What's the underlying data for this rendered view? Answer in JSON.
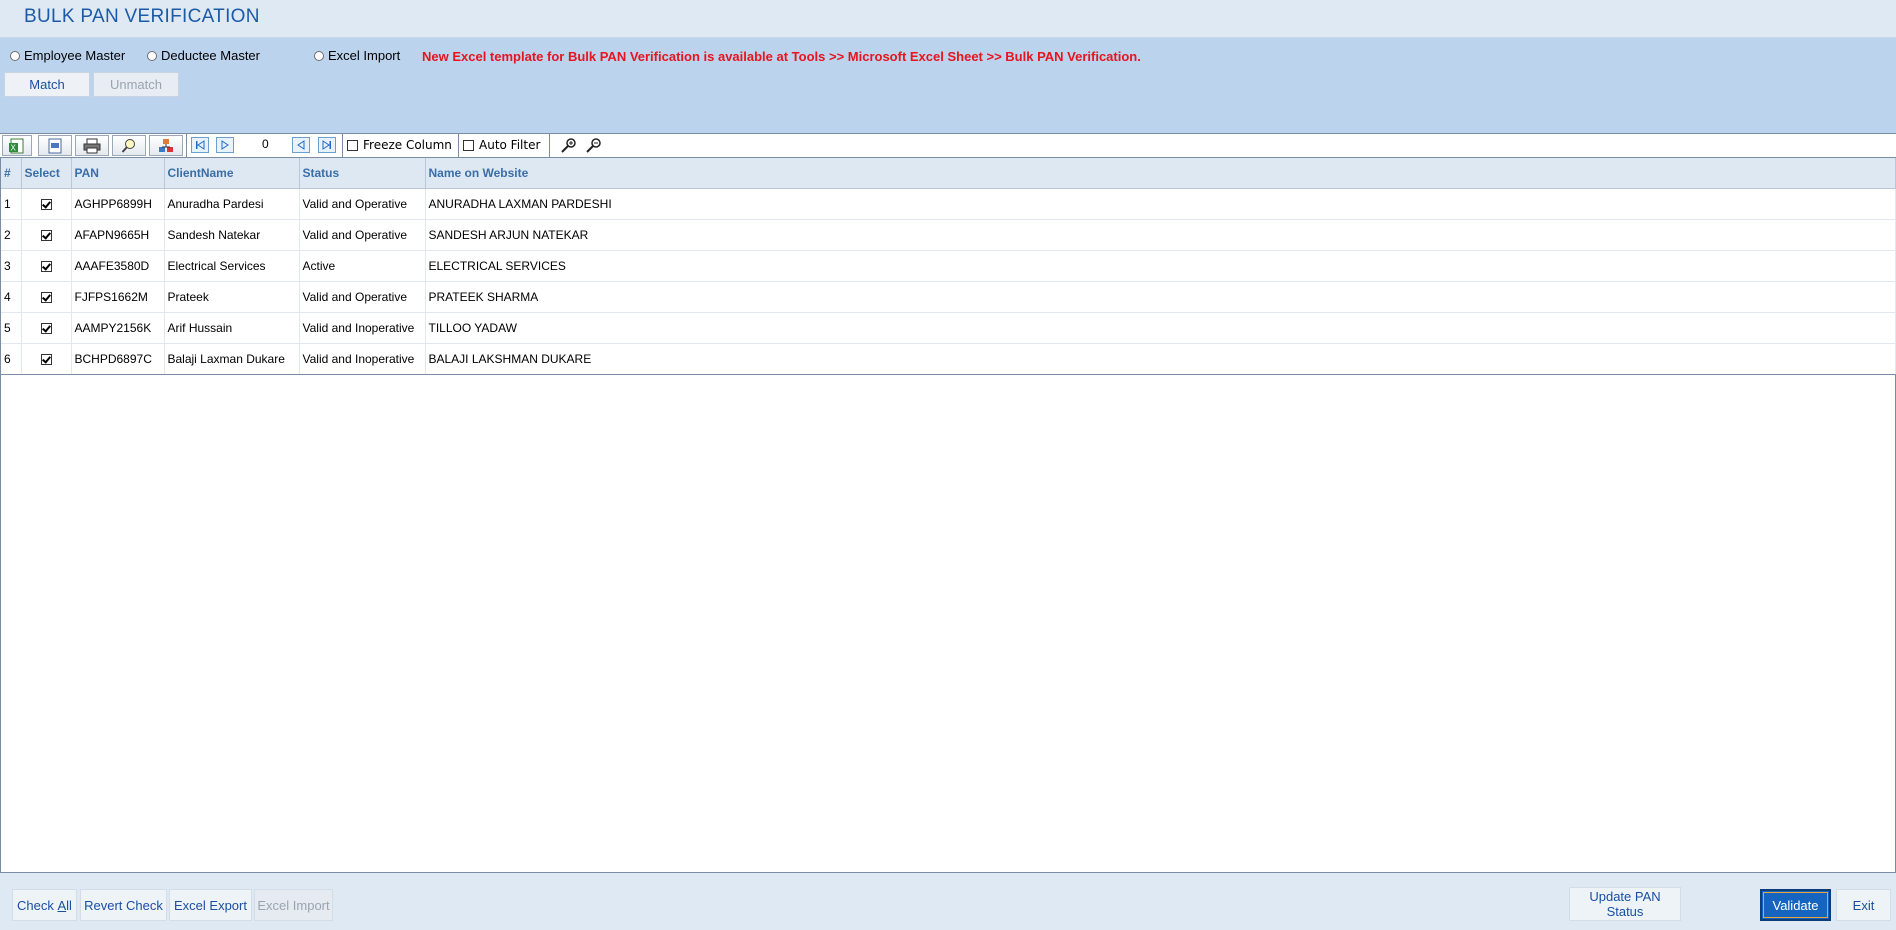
{
  "header": {
    "title": "BULK PAN VERIFICATION"
  },
  "options": {
    "radios": [
      "Employee Master",
      "Deductee Master",
      "Excel Import"
    ],
    "notice": "New Excel template for Bulk PAN Verification is available at Tools >> Microsoft Excel Sheet >> Bulk PAN Verification.",
    "match_label": "Match",
    "unmatch_label": "Unmatch"
  },
  "toolbar": {
    "record_count": "0",
    "freeze_column_label": "Freeze Column",
    "auto_filter_label": "Auto Filter"
  },
  "grid": {
    "columns": [
      "#",
      "Select",
      "PAN",
      "ClientName",
      "Status",
      "Name on Website"
    ],
    "rows": [
      {
        "num": "1",
        "pan": "AGHPP6899H",
        "client": "Anuradha Pardesi",
        "status": "Valid and Operative",
        "website": "ANURADHA LAXMAN PARDESHI"
      },
      {
        "num": "2",
        "pan": "AFAPN9665H",
        "client": "Sandesh Natekar",
        "status": "Valid and Operative",
        "website": "SANDESH ARJUN NATEKAR"
      },
      {
        "num": "3",
        "pan": "AAAFE3580D",
        "client": "Electrical Services",
        "status": "Active",
        "website": "ELECTRICAL SERVICES"
      },
      {
        "num": "4",
        "pan": "FJFPS1662M",
        "client": "Prateek",
        "status": "Valid and Operative",
        "website": "PRATEEK SHARMA"
      },
      {
        "num": "5",
        "pan": "AAMPY2156K",
        "client": "Arif Hussain",
        "status": "Valid and Inoperative",
        "website": "TILLOO YADAW"
      },
      {
        "num": "6",
        "pan": "BCHPD6897C",
        "client": "Balaji Laxman Dukare",
        "status": "Valid and Inoperative",
        "website": "BALAJI LAKSHMAN DUKARE"
      }
    ]
  },
  "footer": {
    "check_all_prefix": "Check ",
    "check_all_underlined": "A",
    "check_all_suffix": "ll",
    "revert_check": "Revert Check",
    "excel_export": "Excel Export",
    "excel_import": "Excel Import",
    "update_pan_status_line1": "Update PAN",
    "update_pan_status_line2": "Status",
    "validate": "Validate",
    "exit": "Exit"
  }
}
